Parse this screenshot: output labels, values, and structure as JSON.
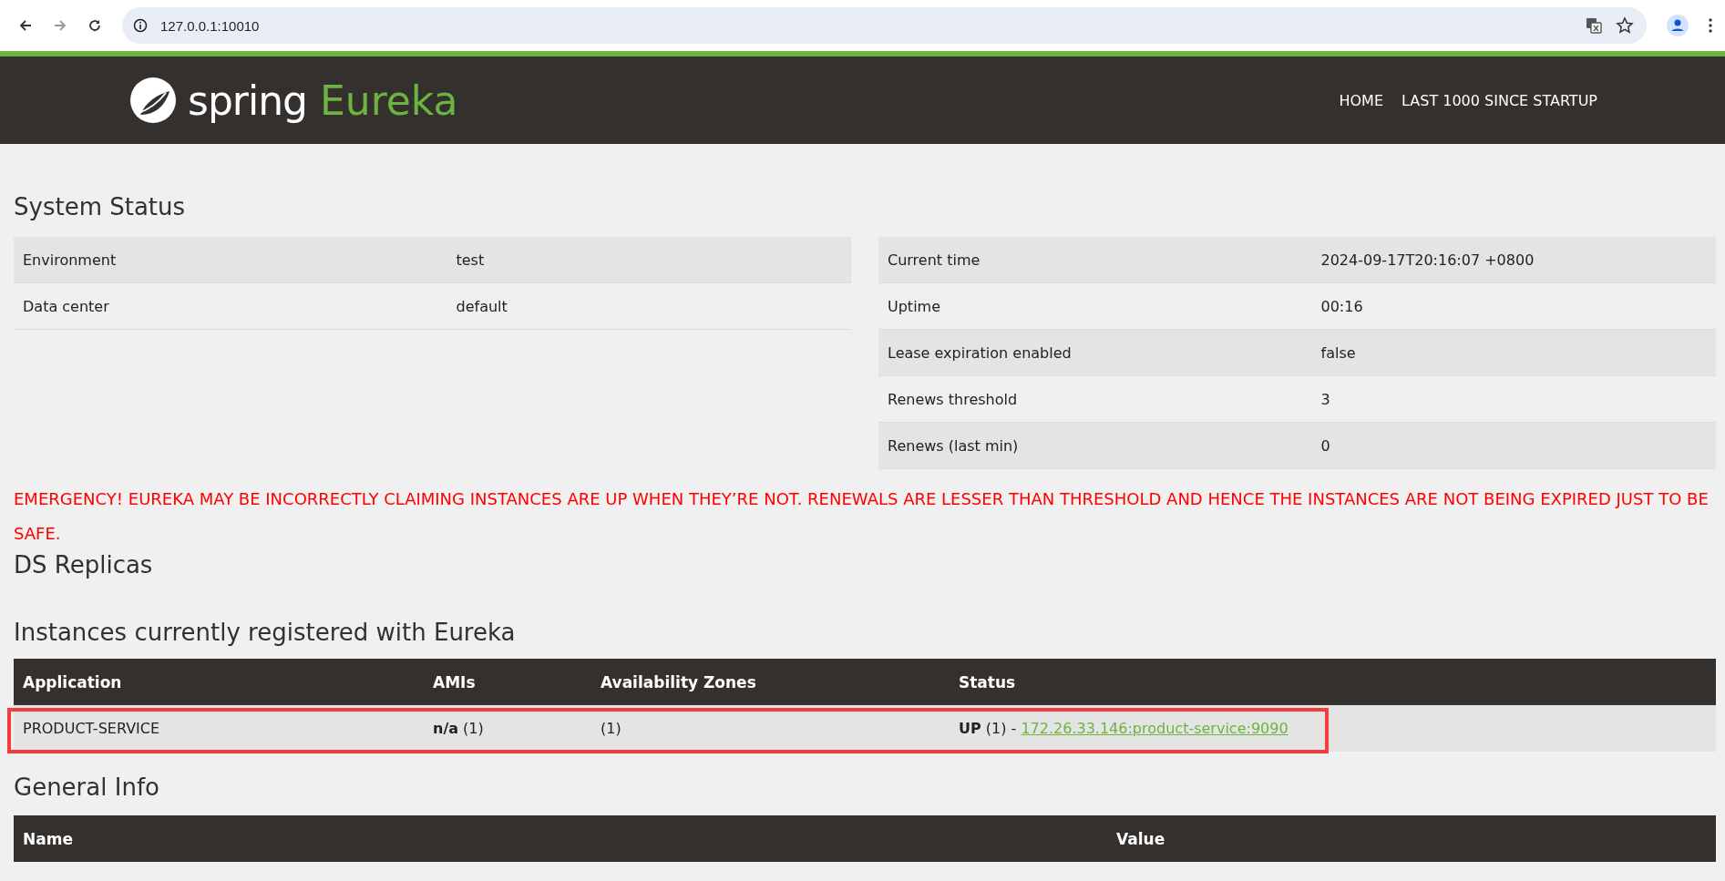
{
  "browser": {
    "url": "127.0.0.1:10010"
  },
  "header": {
    "logo_word": "spring",
    "logo_product": "Eureka",
    "nav": [
      "HOME",
      "LAST 1000 SINCE STARTUP"
    ]
  },
  "system_status": {
    "title": "System Status",
    "left": [
      {
        "name": "Environment",
        "value": "test"
      },
      {
        "name": "Data center",
        "value": "default"
      }
    ],
    "right": [
      {
        "name": "Current time",
        "value": "2024-09-17T20:16:07 +0800"
      },
      {
        "name": "Uptime",
        "value": "00:16"
      },
      {
        "name": "Lease expiration enabled",
        "value": "false"
      },
      {
        "name": "Renews threshold",
        "value": "3"
      },
      {
        "name": "Renews (last min)",
        "value": "0"
      }
    ]
  },
  "warning": "EMERGENCY! EUREKA MAY BE INCORRECTLY CLAIMING INSTANCES ARE UP WHEN THEY’RE NOT. RENEWALS ARE LESSER THAN THRESHOLD AND HENCE THE INSTANCES ARE NOT BEING EXPIRED JUST TO BE SAFE.",
  "ds_replicas": {
    "title": "DS Replicas"
  },
  "instances": {
    "title": "Instances currently registered with Eureka",
    "columns": [
      "Application",
      "AMIs",
      "Availability Zones",
      "Status"
    ],
    "rows": [
      {
        "application": "PRODUCT-SERVICE",
        "amis": "**n/a** (1)",
        "zones": "(1)",
        "status": "**UP** (1) -",
        "instance_link": "172.26.33.146:product-service:9090",
        "highlighted": true
      }
    ]
  },
  "general_info": {
    "title": "General Info",
    "columns": [
      "Name",
      "Value"
    ]
  }
}
